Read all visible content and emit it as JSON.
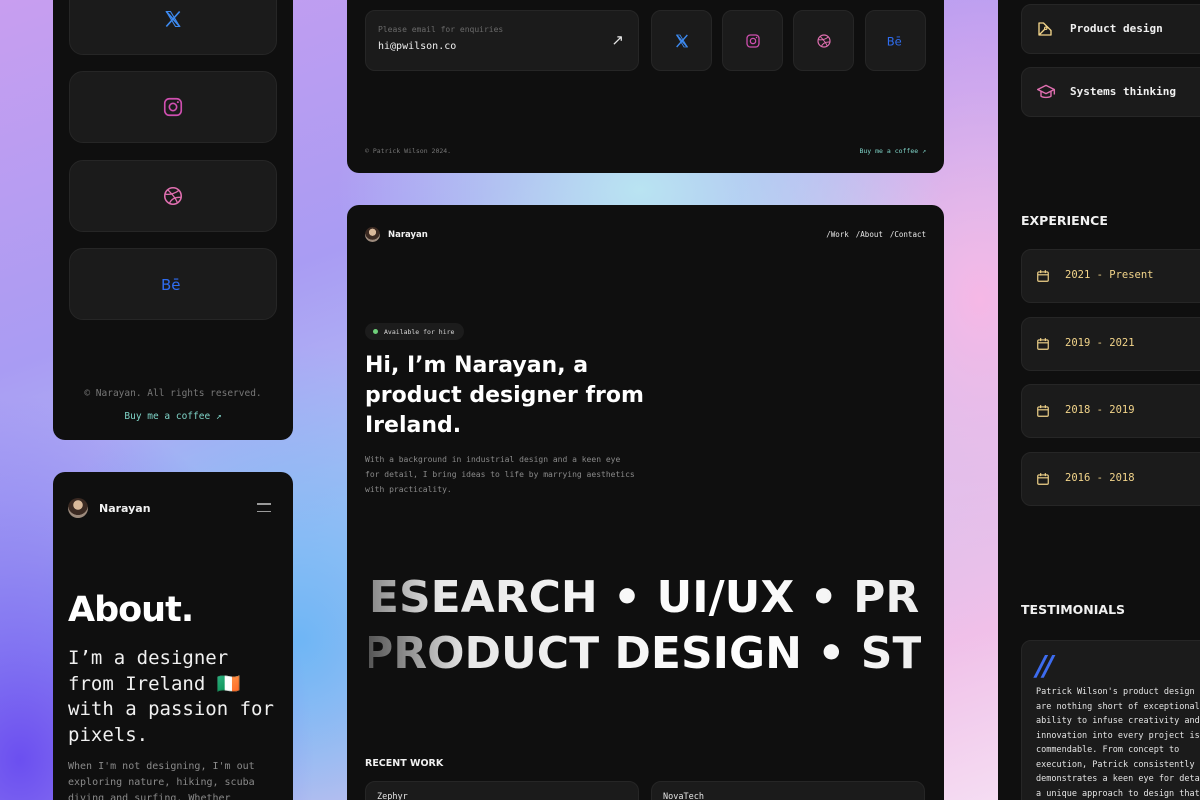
{
  "colors": {
    "panel": "#0f0f0f",
    "tile": "#1b1b1b",
    "accent_teal": "#7fd4c8",
    "accent_gold": "#f2d48a",
    "x_blue": "#3d8af0",
    "instagram_pink": "#d04fb0",
    "dribbble_pink": "#e06fb0",
    "behance_blue": "#2f6df0",
    "available_green": "#6fd07a"
  },
  "left_footer": {
    "social_icons": [
      "x-icon",
      "instagram-icon",
      "dribbble-icon",
      "behance-icon"
    ],
    "copyright": "© Narayan. All rights reserved.",
    "coffee_link": "Buy me a coffee ↗"
  },
  "about_mobile": {
    "brand": "Narayan",
    "title": "About.",
    "intro": "I’m a designer from Ireland 🇮🇪 with a passion for pixels.",
    "body": "When I'm not designing, I'm out exploring nature, hiking, scuba diving and surfing. Whether"
  },
  "contact_footer": {
    "email_placeholder": "Please email for enquiries",
    "email_value": "hi@pwilson.co",
    "arrow": "↗",
    "social_icons": [
      "x-icon",
      "instagram-icon",
      "dribbble-icon",
      "behance-icon"
    ],
    "copyright": "© Patrick Wilson 2024.",
    "coffee_link": "Buy me a coffee ↗"
  },
  "home": {
    "brand": "Narayan",
    "nav": [
      "/Work",
      "/About",
      "/Contact"
    ],
    "badge": "Available for hire",
    "headline": "Hi, I’m Narayan, a product designer from Ireland.",
    "description": "With a background in industrial design and a keen eye for detail, I bring ideas to life by marrying aesthetics with practicality.",
    "marquee_1": "RESEARCH • UI/UX • PRODUCT",
    "marquee_2": "PRODUCT DESIGN • STRATEGY",
    "recent_work_heading": "RECENT WORK",
    "work_items": [
      "Zephyr",
      "NovaTech"
    ]
  },
  "right_panel": {
    "skills": [
      {
        "label": "Product design",
        "icon": "pen-tool-icon"
      },
      {
        "label": "Systems thinking",
        "icon": "graduation-cap-icon"
      }
    ],
    "experience_heading": "EXPERIENCE",
    "experience": [
      "2021 - Present",
      "2019 - 2021",
      "2018 - 2019",
      "2016 - 2018"
    ],
    "testimonials_heading": "TESTIMONIALS",
    "testimonial": "Patrick Wilson's product design s\nare nothing short of exceptional\nability to infuse creativity and\ninnovation into every project is\ncommendable. From concept to\nexecution, Patrick consistently\ndemonstrates a keen eye for detai\na unique approach to design that"
  }
}
